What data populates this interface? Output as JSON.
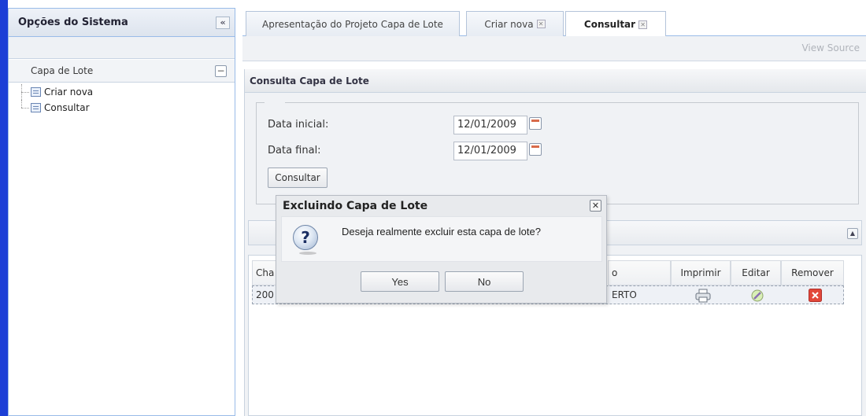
{
  "sidebar": {
    "title": "Opções do Sistema",
    "collapse_icon": "«",
    "section_title": "Capa de Lote",
    "section_toggle": "−",
    "items": [
      {
        "label": "Criar nova"
      },
      {
        "label": "Consultar"
      }
    ]
  },
  "tabs": [
    {
      "label": "Apresentação do Projeto Capa de Lote"
    },
    {
      "label": "Criar nova",
      "close": "✕"
    },
    {
      "label": "Consultar",
      "close": "✕"
    }
  ],
  "view_source": "View Source",
  "consulta": {
    "panel_title": "Consulta Capa de Lote",
    "data_inicial_label": "Data inicial:",
    "data_inicial_value": "12/01/2009",
    "data_final_label": "Data final:",
    "data_final_value": "12/01/2009",
    "consultar_button": "Consultar"
  },
  "grid": {
    "headers": {
      "col1": "Cha",
      "col_status": "o",
      "imprimir": "Imprimir",
      "editar": "Editar",
      "remover": "Remover"
    },
    "row": {
      "col1": "200",
      "status": "ERTO"
    }
  },
  "dialog": {
    "title": "Excluindo Capa de Lote",
    "close": "✕",
    "icon": "?",
    "message": "Deseja realmente excluir esta capa de lote?",
    "yes": "Yes",
    "no": "No"
  }
}
